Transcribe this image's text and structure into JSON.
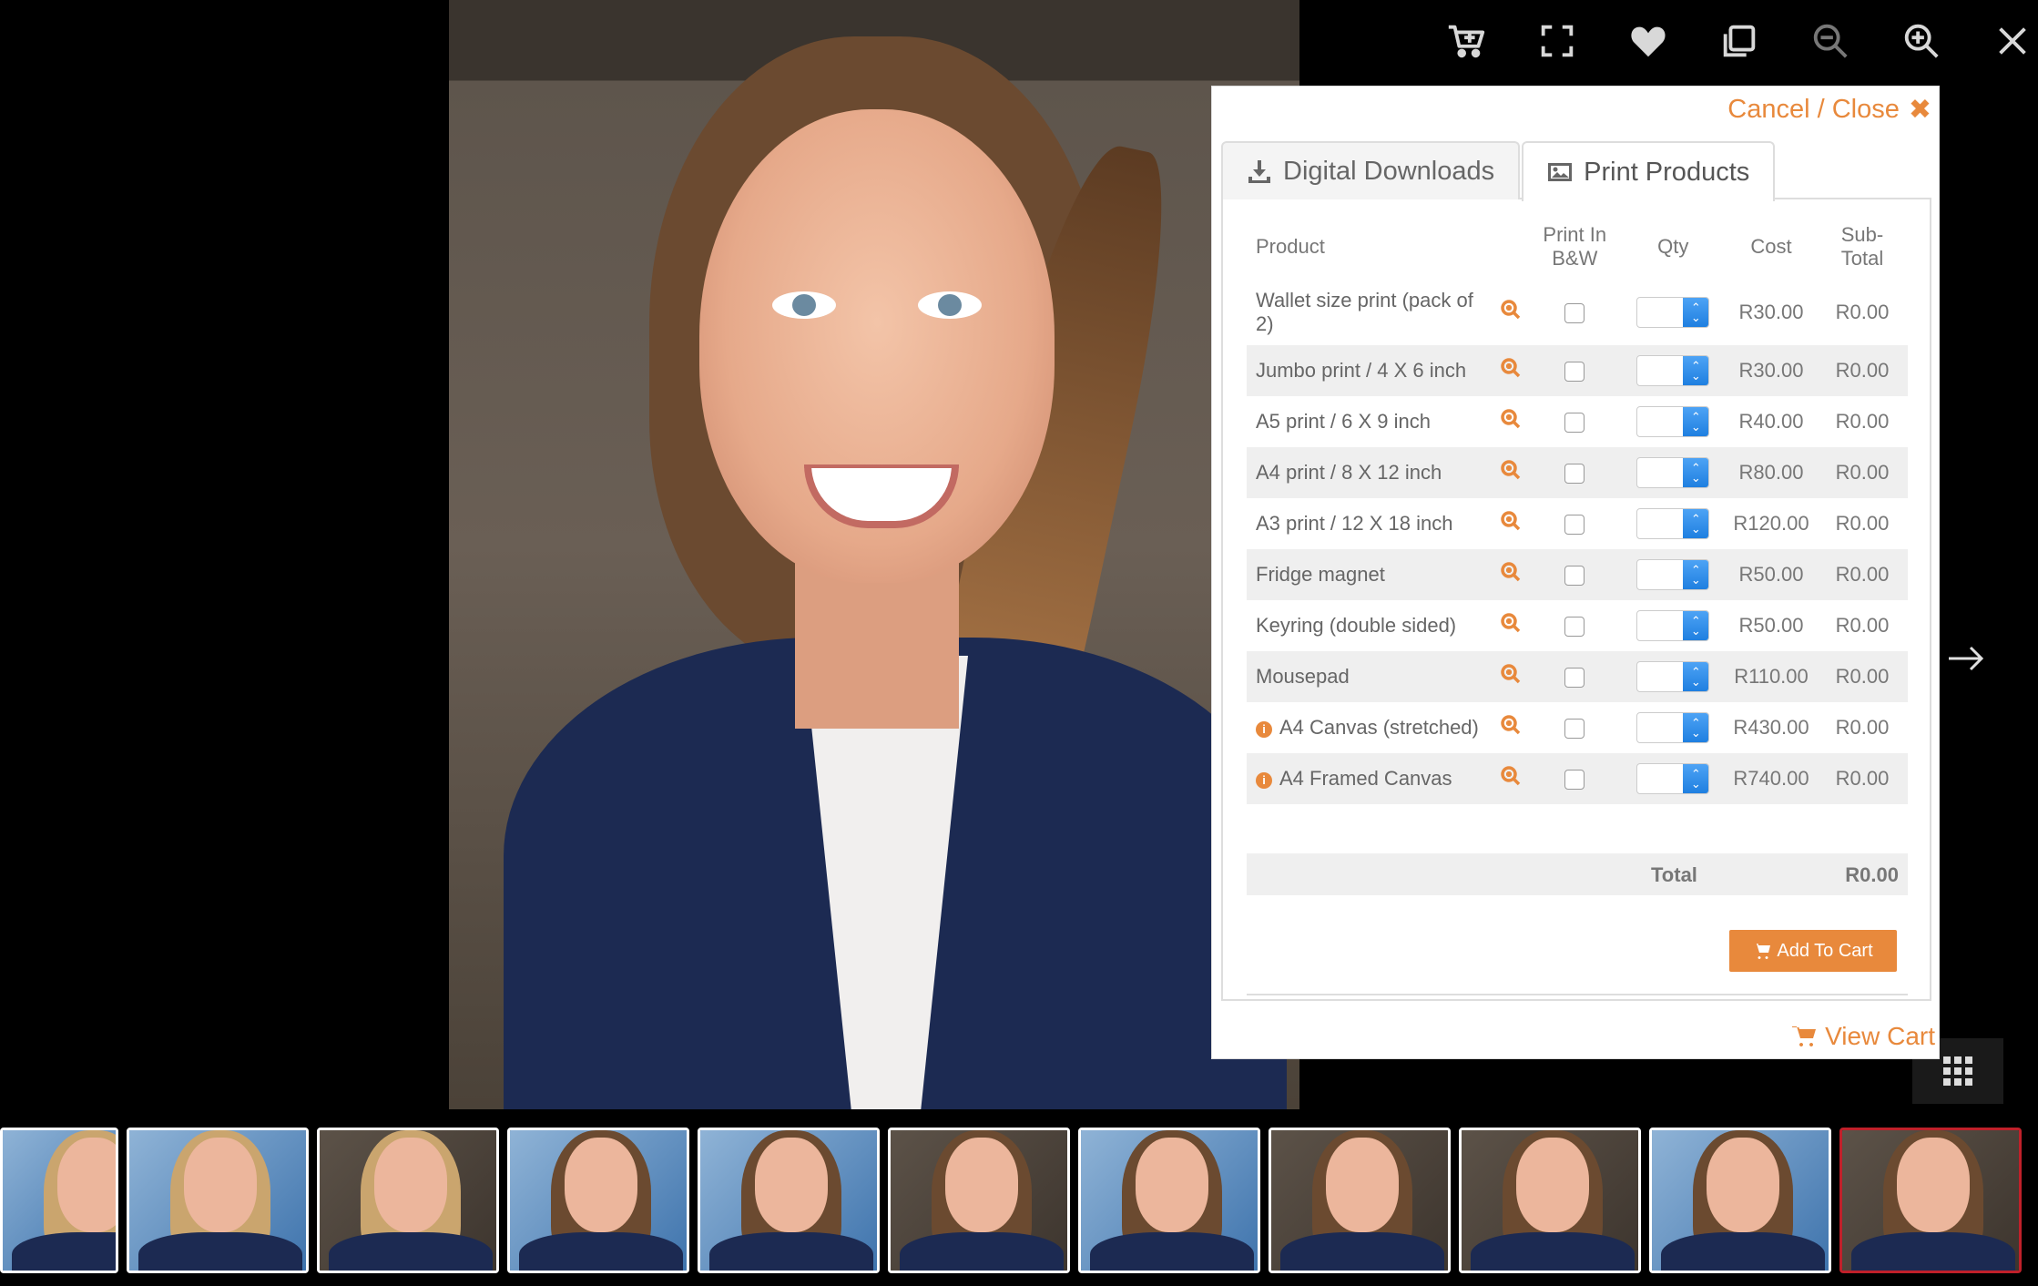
{
  "toolbar": {
    "icons": [
      "add-to-cart-icon",
      "fullscreen-icon",
      "heart-icon",
      "copy-icon",
      "zoom-out-icon",
      "zoom-in-icon",
      "close-icon"
    ]
  },
  "modal": {
    "close_label": "Cancel / Close",
    "close_glyph": "✖",
    "tabs": [
      {
        "label": "Digital Downloads",
        "icon": "download-icon",
        "active": false
      },
      {
        "label": "Print Products",
        "icon": "image-icon",
        "active": true
      }
    ],
    "table": {
      "headers": {
        "product": "Product",
        "bw_line1": "Print In",
        "bw_line2": "B&W",
        "qty": "Qty",
        "cost": "Cost",
        "sub_line1": "Sub-",
        "sub_line2": "Total"
      },
      "rows": [
        {
          "name": "Wallet size print (pack of 2)",
          "cost": "R30.00",
          "subtotal": "R0.00",
          "info": false
        },
        {
          "name": "Jumbo print / 4 X 6 inch",
          "cost": "R30.00",
          "subtotal": "R0.00",
          "info": false
        },
        {
          "name": "A5 print / 6 X 9 inch",
          "cost": "R40.00",
          "subtotal": "R0.00",
          "info": false
        },
        {
          "name": "A4 print / 8 X 12 inch",
          "cost": "R80.00",
          "subtotal": "R0.00",
          "info": false
        },
        {
          "name": "A3 print / 12 X 18 inch",
          "cost": "R120.00",
          "subtotal": "R0.00",
          "info": false
        },
        {
          "name": "Fridge magnet",
          "cost": "R50.00",
          "subtotal": "R0.00",
          "info": false
        },
        {
          "name": "Keyring (double sided)",
          "cost": "R50.00",
          "subtotal": "R0.00",
          "info": false
        },
        {
          "name": "Mousepad",
          "cost": "R110.00",
          "subtotal": "R0.00",
          "info": false
        },
        {
          "name": "A4 Canvas (stretched)",
          "cost": "R430.00",
          "subtotal": "R0.00",
          "info": true
        },
        {
          "name": "A4 Framed Canvas",
          "cost": "R740.00",
          "subtotal": "R0.00",
          "info": true
        }
      ]
    },
    "total_label": "Total",
    "total_value": "R0.00",
    "add_to_cart_label": "Add To Cart",
    "view_cart_label": "View Cart"
  },
  "colors": {
    "accent": "#e8893c",
    "selected_thumb_border": "#c0202a",
    "spinner_blue": "#2a86e6"
  },
  "thumbnails": [
    {
      "bg": "blue",
      "hair": "blonde",
      "selected": false
    },
    {
      "bg": "blue",
      "hair": "blonde",
      "selected": false
    },
    {
      "bg": "brown",
      "hair": "blonde",
      "selected": false
    },
    {
      "bg": "blue",
      "hair": "brown",
      "selected": false
    },
    {
      "bg": "blue",
      "hair": "brown",
      "selected": false
    },
    {
      "bg": "brown",
      "hair": "brown",
      "selected": false
    },
    {
      "bg": "blue",
      "hair": "brown",
      "selected": false
    },
    {
      "bg": "brown",
      "hair": "brown",
      "selected": false
    },
    {
      "bg": "brown",
      "hair": "brown",
      "selected": false
    },
    {
      "bg": "blue",
      "hair": "brown",
      "selected": false
    },
    {
      "bg": "brown",
      "hair": "brown",
      "selected": true
    }
  ]
}
